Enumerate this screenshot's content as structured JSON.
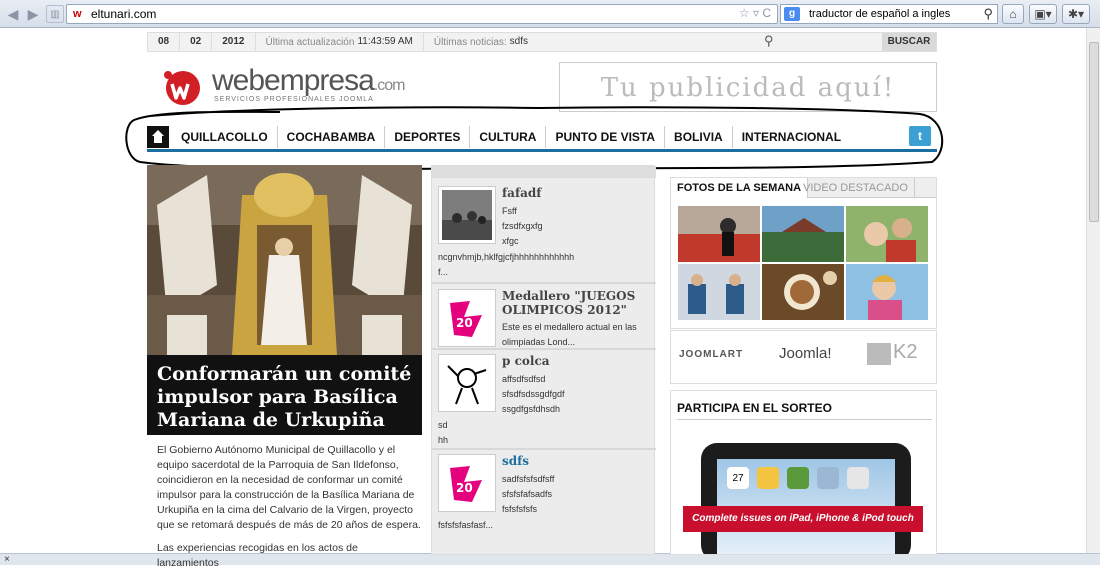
{
  "browser": {
    "url": "eltunari.com",
    "search_text": "traductor de español a ingles",
    "status_close": "×"
  },
  "topstrip": {
    "day": "08",
    "month": "02",
    "year": "2012",
    "update_label": "Última actualización",
    "update_time": "11:43:59 AM",
    "news_label": "Últimas noticias:",
    "news_value": "sdfs",
    "search_button": "BUSCAR"
  },
  "logo": {
    "name": "webempresa",
    "suffix": ".com",
    "tagline": "SERVICIOS PROFESIONALES JOOMLA"
  },
  "ad_text": "Tu publicidad aquí!",
  "menu": {
    "items": [
      "QUILLACOLLO",
      "COCHABAMBA",
      "DEPORTES",
      "CULTURA",
      "PUNTO DE VISTA",
      "BOLIVIA",
      "INTERNACIONAL"
    ]
  },
  "hero": {
    "title": "Conformarán un comité impulsor para Basílica Mariana de Urkupiña",
    "p1": "El Gobierno Autónomo Municipal de Quillacollo y el equipo sacerdotal de la Parroquia de San Ildefonso, coincidieron en la necesidad de conformar un comité impulsor para la construcción de la Basílica Mariana de Urkupiña en la cima del Calvario de la Virgen, proyecto que se retomará después de más de 20 años de espera.",
    "p2": "Las experiencias recogidas en los actos de lanzamientos"
  },
  "news": [
    {
      "title": "fafadf",
      "lines": [
        "Fsff",
        "fzsdfxgxfg",
        "xfgc"
      ],
      "full": [
        "ncgnvhmjb,hklfgjcfjhhhhhhhhhhhh",
        "f..."
      ]
    },
    {
      "title": "Medallero \"JUEGOS OLIMPICOS 2012\"",
      "lines": [
        "Este es el medallero actual en las olimpiadas Lond..."
      ],
      "full": []
    },
    {
      "title": "p colca",
      "lines": [
        "affsdfsdfsd",
        "sfsdfsdssgdfgdf",
        "ssgdfgsfdhsdh"
      ],
      "full": [
        "sd",
        "hh"
      ]
    },
    {
      "title": "sdfs",
      "lines": [
        "sadfsfsfsdfsff",
        "sfsfsfafsadfs",
        "fsfsfsfsfs"
      ],
      "full": [
        "fsfsfsfasfasf..."
      ]
    }
  ],
  "right": {
    "tab_photos": "FOTOS DE LA SEMANA",
    "tab_video": "VIDEO DESTACADO",
    "partners": [
      "JOOMLART",
      "Joomla!",
      "K2"
    ],
    "sorteo_title": "PARTICIPA EN EL SORTEO",
    "ribbon": "Complete issues on iPad, iPhone & iPod touch",
    "calendar_day": "27"
  },
  "colors": {
    "accent": "#1a6ea0",
    "logo_red": "#d21f26",
    "ribbon": "#c8102e",
    "twitter": "#3ba0d4"
  }
}
